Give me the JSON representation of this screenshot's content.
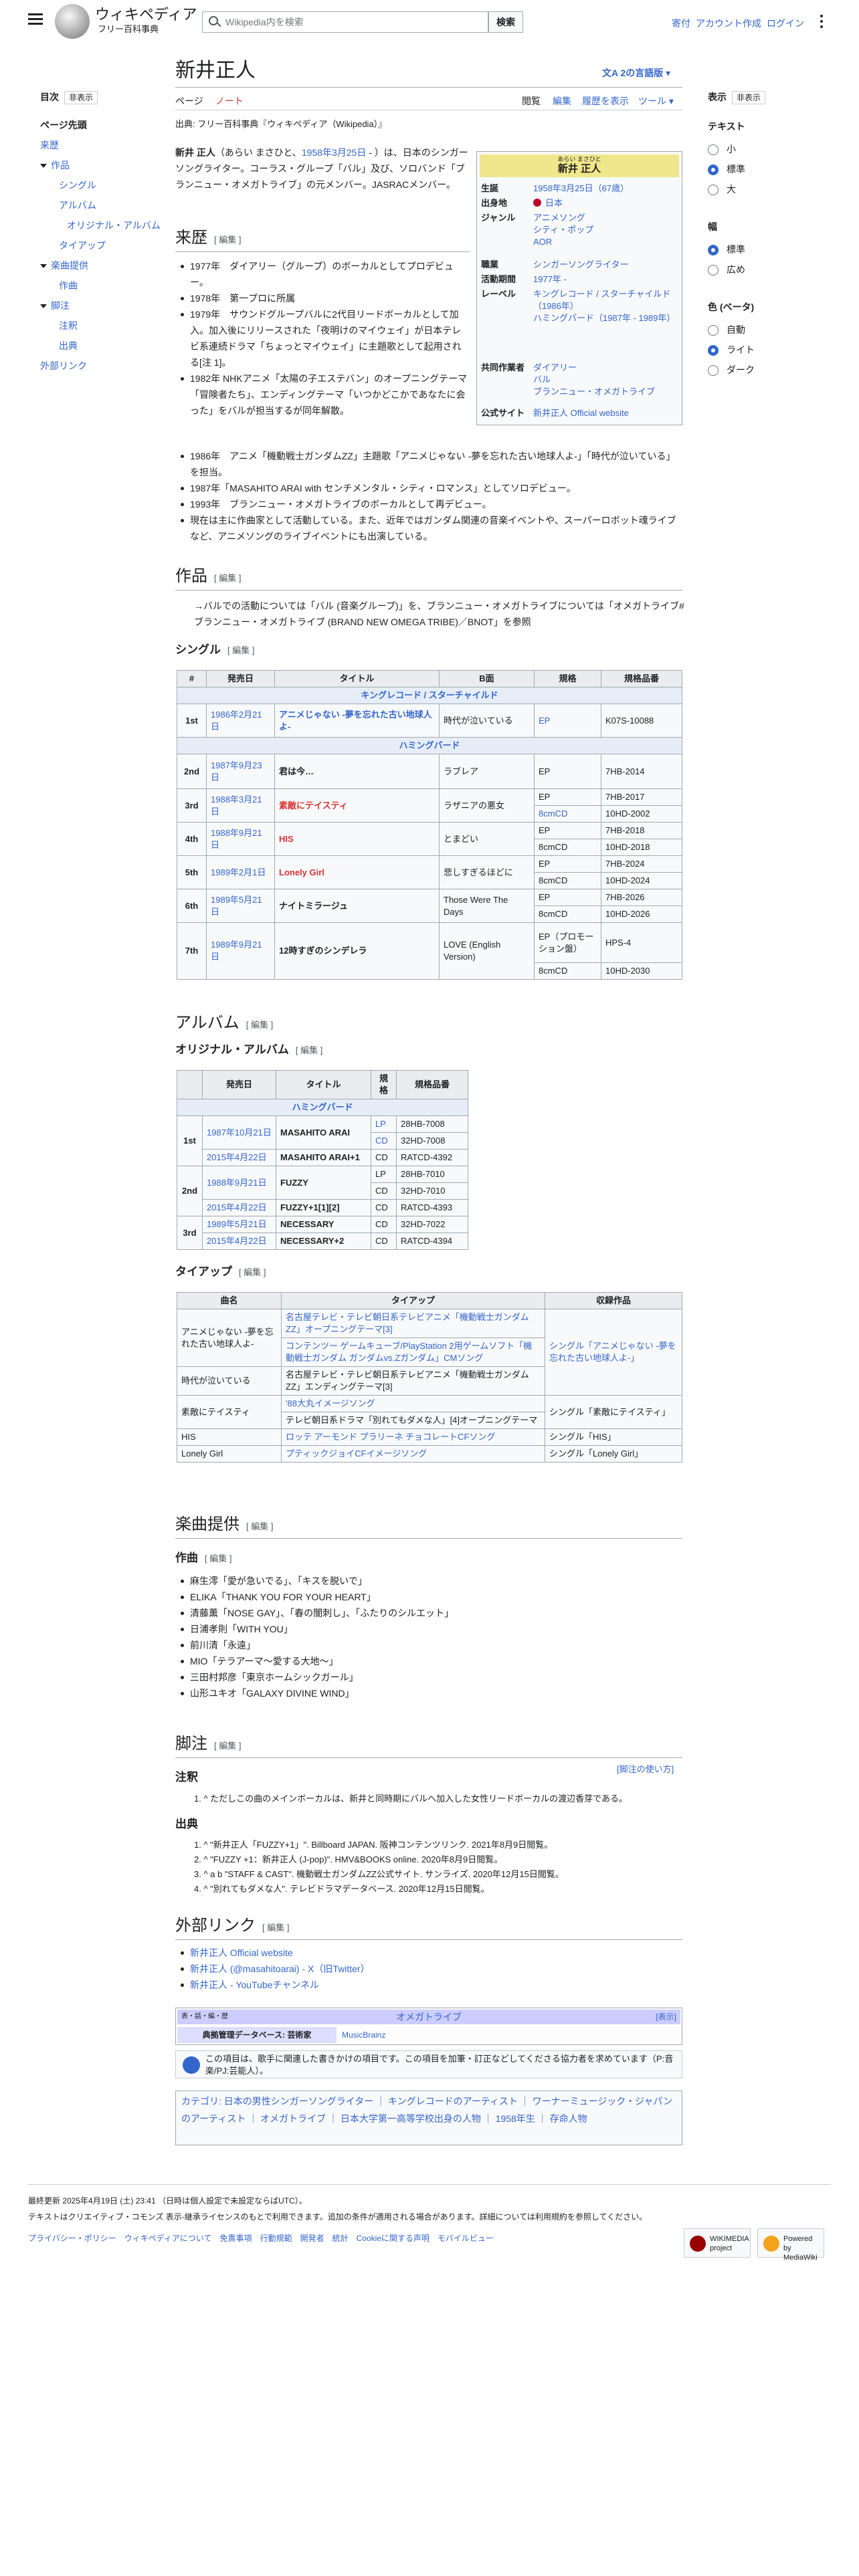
{
  "header": {
    "wordmark": "ウィキペディア",
    "tagline": "フリー百科事典",
    "search_placeholder": "Wikipedia内を検索",
    "search_button": "検索",
    "links": [
      "寄付",
      "アカウント作成",
      "ログイン"
    ]
  },
  "toc": {
    "title": "目次",
    "hide": "非表示",
    "items": [
      "ページ先頭",
      "来歴",
      "作品",
      "シングル",
      "アルバム",
      "オリジナル・アルバム",
      "タイアップ",
      "楽曲提供",
      "作曲",
      "脚注",
      "注釈",
      "出典",
      "外部リンク"
    ]
  },
  "appearance": {
    "title": "表示",
    "hide": "非表示",
    "text_label": "テキスト",
    "text_options": [
      "小",
      "標準",
      "大"
    ],
    "width_label": "幅",
    "width_options": [
      "標準",
      "広め"
    ],
    "color_label": "色 (ベータ)",
    "color_options": [
      "自動",
      "ライト",
      "ダーク"
    ]
  },
  "page": {
    "title": "新井正人",
    "languages": "2の言語版",
    "tabs_left": [
      "ページ",
      "ノート"
    ],
    "tabs_right": [
      "閲覧",
      "編集",
      "履歴を表示",
      "ツール"
    ],
    "source": "出典: フリー百科事典『ウィキペディア（Wikipedia）』",
    "edit": "[ 編集 ]"
  },
  "intro": {
    "name": "新井 正人",
    "p1": "（あらい まさひと、",
    "birth": "1958年3月25日",
    "p2": " - ）は、日本のシンガーソングライター。コーラス・グループ「バル」及び、ソロバンド「ブランニュー・オメガトライブ」の元メンバー。JASRACメンバー。"
  },
  "infobox": {
    "kana": "あらい まさひと",
    "name": "新井 正人",
    "rows": [
      {
        "k": "生誕",
        "v": "1958年3月25日（67歳）"
      },
      {
        "k": "出身地",
        "v": "日本"
      },
      {
        "k": "ジャンル",
        "v": "アニメソング\nシティ・ポップ\nAOR"
      },
      {
        "k": "職業",
        "v": "シンガーソングライター"
      },
      {
        "k": "活動期間",
        "v": "1977年 -"
      },
      {
        "k": "レーベル",
        "v": "キングレコード / スターチャイルド（1986年）\nハミングバード（1987年 - 1989年）"
      },
      {
        "k": "共同作業者",
        "v": "ダイアリー\nバル\nブランニュー・オメガトライブ"
      },
      {
        "k": "公式サイト",
        "v": "新井正人 Official website"
      }
    ]
  },
  "history": {
    "heading": "来歴",
    "items": [
      "1977年　ダイアリー（グループ）のボーカルとしてプロデビュー。",
      "1978年　第一プロに所属",
      "1979年　サウンドグループバルに2代目リードボーカルとして加入。加入後にリリースされた「夜明けのマイウェイ」が日本テレビ系連続ドラマ「ちょっとマイウェイ」に主題歌として起用される[注 1]。",
      "1982年 NHKアニメ「太陽の子エステバン」のオープニングテーマ「冒険者たち」、エンディングテーマ「いつかどこかであなたに会った」をバルが担当するが同年解散。",
      "1986年　アニメ「機動戦士ガンダムZZ」主題歌「アニメじゃない -夢を忘れた古い地球人よ-」「時代が泣いている」を担当。",
      "1987年「MASAHITO ARAI with センチメンタル・シティ・ロマンス」としてソロデビュー。",
      "1993年　ブランニュー・オメガトライブのボーカルとして再デビュー。",
      "現在は主に作曲家として活動している。また、近年ではガンダム関連の音楽イベントや、スーパーロボット魂ライブなど、アニメソングのライブイベントにも出演している。"
    ]
  },
  "works": {
    "heading": "作品",
    "hatnote": "→バルでの活動については「バル (音楽グループ)」を、ブランニュー・オメガトライブについては「オメガトライブ#ブランニュー・オメガトライブ (BRAND NEW OMEGA TRIBE)／BNOT」を参照"
  },
  "singles": {
    "heading": "シングル",
    "headers": [
      "#",
      "発売日",
      "タイトル",
      "B面",
      "規格",
      "規格品番"
    ],
    "label1": "キングレコード / スターチャイルド",
    "label2": "ハミングバード",
    "r1": {
      "n": "1st",
      "date": "1986年2月21日",
      "title": "アニメじゃない -夢を忘れた古い地球人よ-",
      "b": "時代が泣いている",
      "f": "EP",
      "no": "K07S-10088"
    },
    "r2": {
      "n": "2nd",
      "date": "1987年9月23日",
      "title": "君は今…",
      "b": "ラブレア",
      "f": "EP",
      "no": "7HB-2014"
    },
    "r3": {
      "n": "3rd",
      "date": "1988年3月21日",
      "title": "素敵にテイスティ",
      "b": "ラザニアの悪女",
      "f1": "EP",
      "no1": "7HB-2017",
      "f2": "8cmCD",
      "no2": "10HD-2002"
    },
    "r4": {
      "n": "4th",
      "date": "1988年9月21日",
      "title": "HIS",
      "b": "とまどい",
      "f1": "EP",
      "no1": "7HB-2018",
      "f2": "8cmCD",
      "no2": "10HD-2018"
    },
    "r5": {
      "n": "5th",
      "date": "1989年2月1日",
      "title": "Lonely Girl",
      "b": "悲しすぎるほどに",
      "f1": "EP",
      "no1": "7HB-2024",
      "f2": "8cmCD",
      "no2": "10HD-2024"
    },
    "r6": {
      "n": "6th",
      "date": "1989年5月21日",
      "title": "ナイトミラージュ",
      "b": "Those Were The Days",
      "f1": "EP",
      "no1": "7HB-2026",
      "f2": "8cmCD",
      "no2": "10HD-2026"
    },
    "r7": {
      "n": "7th",
      "date": "1989年9月21日",
      "title": "12時すぎのシンデレラ",
      "b": "LOVE (English Version)",
      "f1": "EP（プロモーション盤）",
      "no1": "HPS-4",
      "f2": "8cmCD",
      "no2": "10HD-2030"
    }
  },
  "albums": {
    "heading": "アルバム",
    "sub": "オリジナル・アルバム",
    "headers": [
      "",
      "発売日",
      "タイトル",
      "規格",
      "規格品番"
    ],
    "label": "ハミングバード",
    "a1": {
      "n": "1st",
      "d1": "1987年10月21日",
      "t1": "MASAHITO ARAI",
      "f1": "LP",
      "no1": "28HB-7008",
      "f2": "CD",
      "no2": "32HD-7008",
      "d3": "2015年4月22日",
      "t3": "MASAHITO ARAI+1",
      "f3": "CD",
      "no3": "RATCD-4392"
    },
    "a2": {
      "n": "2nd",
      "d1": "1988年9月21日",
      "t1": "FUZZY",
      "f1": "LP",
      "no1": "28HB-7010",
      "f2": "CD",
      "no2": "32HD-7010",
      "d3": "2015年4月22日",
      "t3": "FUZZY+1[1][2]",
      "f3": "CD",
      "no3": "RATCD-4393"
    },
    "a3": {
      "n": "3rd",
      "d1": "1989年5月21日",
      "t1": "NECESSARY",
      "f1": "CD",
      "no1": "32HD-7022",
      "d2": "2015年4月22日",
      "t2": "NECESSARY+2",
      "f2": "CD",
      "no2": "RATCD-4394"
    }
  },
  "tieups": {
    "heading": "タイアップ",
    "headers": [
      "曲名",
      "タイアップ",
      "収録作品"
    ],
    "rows": [
      {
        "song": "アニメじゃない -夢を忘れた古い地球人よ-",
        "tie1": "名古屋テレビ・テレビ朝日系テレビアニメ「機動戦士ガンダムZZ」オープニングテーマ[3]",
        "tie2": "コンテンツー ゲームキューブ/PlayStation 2用ゲームソフト「機動戦士ガンダム ガンダムvs.Zガンダム」CMソング",
        "rec": "シングル「アニメじゃない -夢を忘れた古い地球人よ-」"
      },
      {
        "song": "時代が泣いている",
        "tie1": "名古屋テレビ・テレビ朝日系テレビアニメ「機動戦士ガンダムZZ」エンディングテーマ[3]",
        "rec": ""
      },
      {
        "song": "素敵にテイスティ",
        "tie1": "'88大丸イメージソング",
        "tie2": "テレビ朝日系ドラマ「別れてもダメな人」[4]オープニングテーマ",
        "rec": "シングル「素敵にテイスティ」"
      },
      {
        "song": "HIS",
        "tie1": "ロッテ アーモンド プラリーネ チョコレートCFソング",
        "rec": "シングル「HIS」"
      },
      {
        "song": "Lonely Girl",
        "tie1": "プティックジョイCFイメージソング",
        "rec": "シングル「Lonely Girl」"
      }
    ]
  },
  "provided": {
    "heading": "楽曲提供",
    "sub": "作曲",
    "items": [
      "麻生澪「愛が急いでる」、「キスを脱いで」",
      "ELIKA「THANK YOU FOR YOUR HEART」",
      "清藤薫「NOSE GAY」、「春の闇刺し」、「ふたりのシルエット」",
      "日浦孝則「WITH YOU」",
      "前川清「永遠」",
      "MIO「テラアーマ〜愛する大地〜」",
      "三田村邦彦「東京ホームシックガール」",
      "山形ユキオ「GALAXY DIVINE WIND」"
    ]
  },
  "notes": {
    "heading": "脚注",
    "howto": "[脚注の使い方]",
    "sub1": "注釈",
    "n1": "1. ^ ただしこの曲のメインボーカルは、新井と同時期にバルへ加入した女性リードボーカルの渡辺香芽である。",
    "sub2": "出典",
    "refs": [
      "1. ^ \"新井正人「FUZZY+1」\". Billboard JAPAN. 阪神コンテンツリンク. 2021年8月9日閲覧。",
      "2. ^ \"FUZZY +1：新井正人 (J-pop)\". HMV&BOOKS online. 2020年8月9日閲覧。",
      "3. ^ a b \"STAFF & CAST\". 機動戦士ガンダムZZ公式サイト. サンライズ. 2020年12月15日閲覧。",
      "4. ^ \"別れてもダメな人\". テレビドラマデータベース. 2020年12月15日閲覧。"
    ]
  },
  "external": {
    "heading": "外部リンク",
    "items": [
      "新井正人 Official website",
      "新井正人 (@masahitoarai) - X（旧Twitter）",
      "新井正人 - YouTubeチャンネル"
    ]
  },
  "navbox": {
    "vte": "表・話・編・歴",
    "title": "オメガトライブ",
    "show": "[表示]",
    "row_k": "典拠管理データベース: 芸術家",
    "row_v": "MusicBrainz"
  },
  "stub": {
    "text": "この項目は、歌手に関連した書きかけの項目です。この項目を加筆・訂正などしてくださる協力者を求めています（P:音楽/PJ:芸能人）。"
  },
  "categories": {
    "text": "カテゴリ: 日本の男性シンガーソングライター ｜ キングレコードのアーティスト ｜ ワーナーミュージック・ジャパンのアーティスト ｜ オメガトライブ ｜ 日本大学第一高等学校出身の人物 ｜ 1958年生 ｜ 存命人物"
  },
  "footer": {
    "modified": "最終更新 2025年4月19日 (土) 23:41 （日時は個人設定で未設定ならばUTC）。",
    "license": "テキストはクリエイティブ・コモンズ 表示-継承ライセンスのもとで利用できます。追加の条件が適用される場合があります。詳細については利用規約を参照してください。",
    "links": "プライバシー・ポリシー　ウィキペディアについて　免責事項　行動規範　開発者　統計　Cookieに関する声明　モバイルビュー",
    "badge1": "WIKIMEDIA project",
    "badge2": "Powered by MediaWiki"
  }
}
